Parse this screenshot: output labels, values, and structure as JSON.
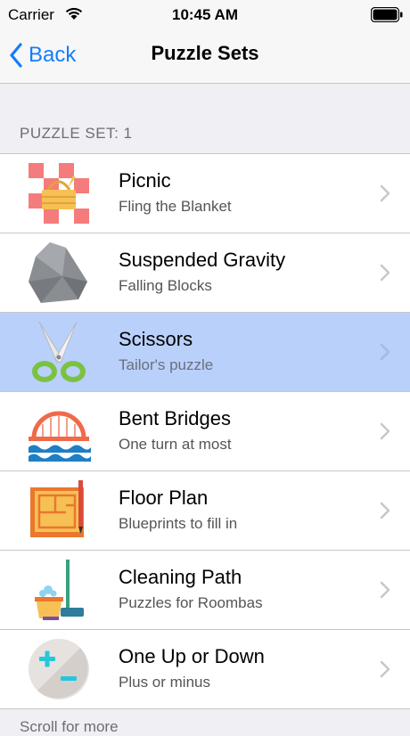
{
  "status": {
    "carrier": "Carrier",
    "time": "10:45 AM"
  },
  "nav": {
    "back_label": "Back",
    "title": "Puzzle Sets"
  },
  "section": {
    "header": "PUZZLE SET: 1"
  },
  "rows": [
    {
      "title": "Picnic",
      "subtitle": "Fling the Blanket",
      "icon": "picnic-basket-icon"
    },
    {
      "title": "Suspended Gravity",
      "subtitle": "Falling Blocks",
      "icon": "rock-icon"
    },
    {
      "title": "Scissors",
      "subtitle": "Tailor's puzzle",
      "icon": "scissors-icon",
      "selected": true
    },
    {
      "title": "Bent Bridges",
      "subtitle": "One turn at most",
      "icon": "bridge-icon"
    },
    {
      "title": "Floor Plan",
      "subtitle": "Blueprints to fill in",
      "icon": "blueprint-icon"
    },
    {
      "title": "Cleaning Path",
      "subtitle": "Puzzles for Roombas",
      "icon": "mop-bucket-icon"
    },
    {
      "title": "One Up or Down",
      "subtitle": "Plus or minus",
      "icon": "plus-minus-icon"
    }
  ],
  "footer": {
    "text": "Scroll for more"
  },
  "colors": {
    "accent": "#147efb",
    "selected_row": "#b9d0fb",
    "background": "#efeff4"
  }
}
